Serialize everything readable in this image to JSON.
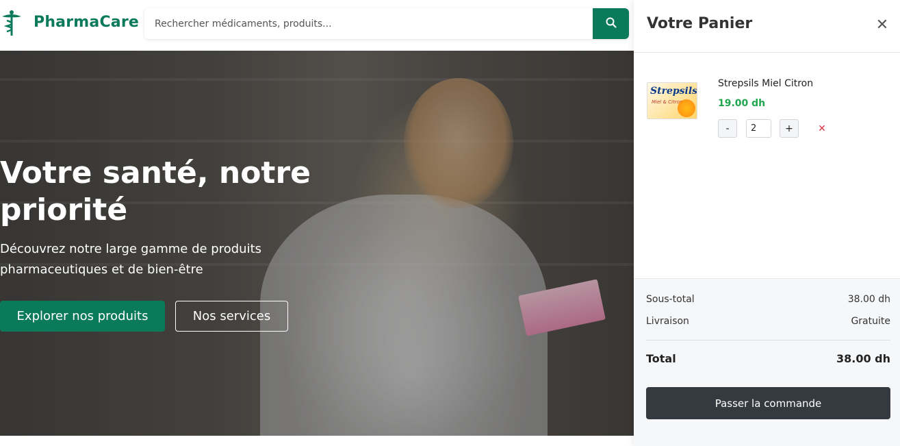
{
  "brand": {
    "name": "PharmaCare",
    "logo_icon": "caduceus-icon",
    "color": "#0b7a5b"
  },
  "search": {
    "placeholder": "Rechercher médicaments, produits...",
    "icon": "search-icon"
  },
  "hero": {
    "title": "Votre santé, notre priorité",
    "subtitle": "Découvrez notre large gamme de produits pharmaceutiques et de bien-être",
    "primary_button": "Explorer nos produits",
    "secondary_button": "Nos services"
  },
  "cart": {
    "title": "Votre Panier",
    "close_icon": "close-icon",
    "items": [
      {
        "name": "Strepsils Miel Citron",
        "price": "19.00 dh",
        "quantity": "2",
        "image_brand": "Strepsils",
        "image_subtext": "Miel & Citron"
      }
    ],
    "subtotal_label": "Sous-total",
    "subtotal_value": "38.00 dh",
    "delivery_label": "Livraison",
    "delivery_value": "Gratuite",
    "total_label": "Total",
    "total_value": "38.00 dh",
    "checkout_button": "Passer la commande",
    "price_color": "#1fa54d",
    "remove_color": "#dc3545"
  }
}
